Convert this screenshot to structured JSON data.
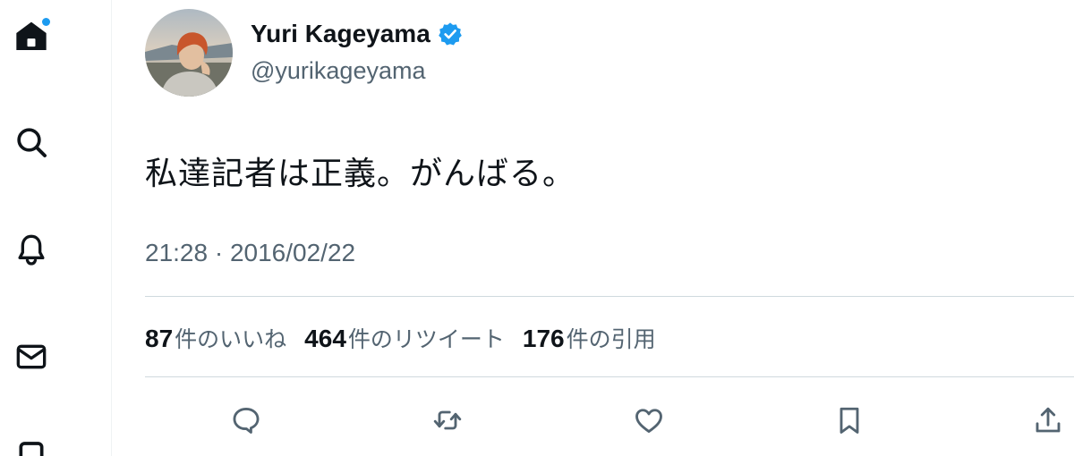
{
  "nav": {
    "items": [
      {
        "name": "home",
        "icon": "home-icon",
        "has_notification": true
      },
      {
        "name": "explore",
        "icon": "search-icon"
      },
      {
        "name": "notifications",
        "icon": "bell-icon"
      },
      {
        "name": "messages",
        "icon": "mail-icon"
      },
      {
        "name": "more",
        "icon": "bookmark-icon"
      }
    ]
  },
  "tweet": {
    "author": {
      "display_name": "Yuri Kageyama",
      "handle": "@yurikageyama",
      "verified": true
    },
    "text": "私達記者は正義。がんばる。",
    "timestamp": "21:28 · 2016/02/22",
    "stats": [
      {
        "count": "87",
        "label": "件のいいね"
      },
      {
        "count": "464",
        "label": "件のリツイート"
      },
      {
        "count": "176",
        "label": "件の引用"
      }
    ],
    "actions": [
      "reply-icon",
      "retweet-icon",
      "like-icon",
      "bookmark-icon",
      "share-icon"
    ]
  },
  "colors": {
    "text_primary": "#0f1419",
    "text_secondary": "#536471",
    "accent": "#1d9bf0",
    "divider": "#cfd9de"
  }
}
